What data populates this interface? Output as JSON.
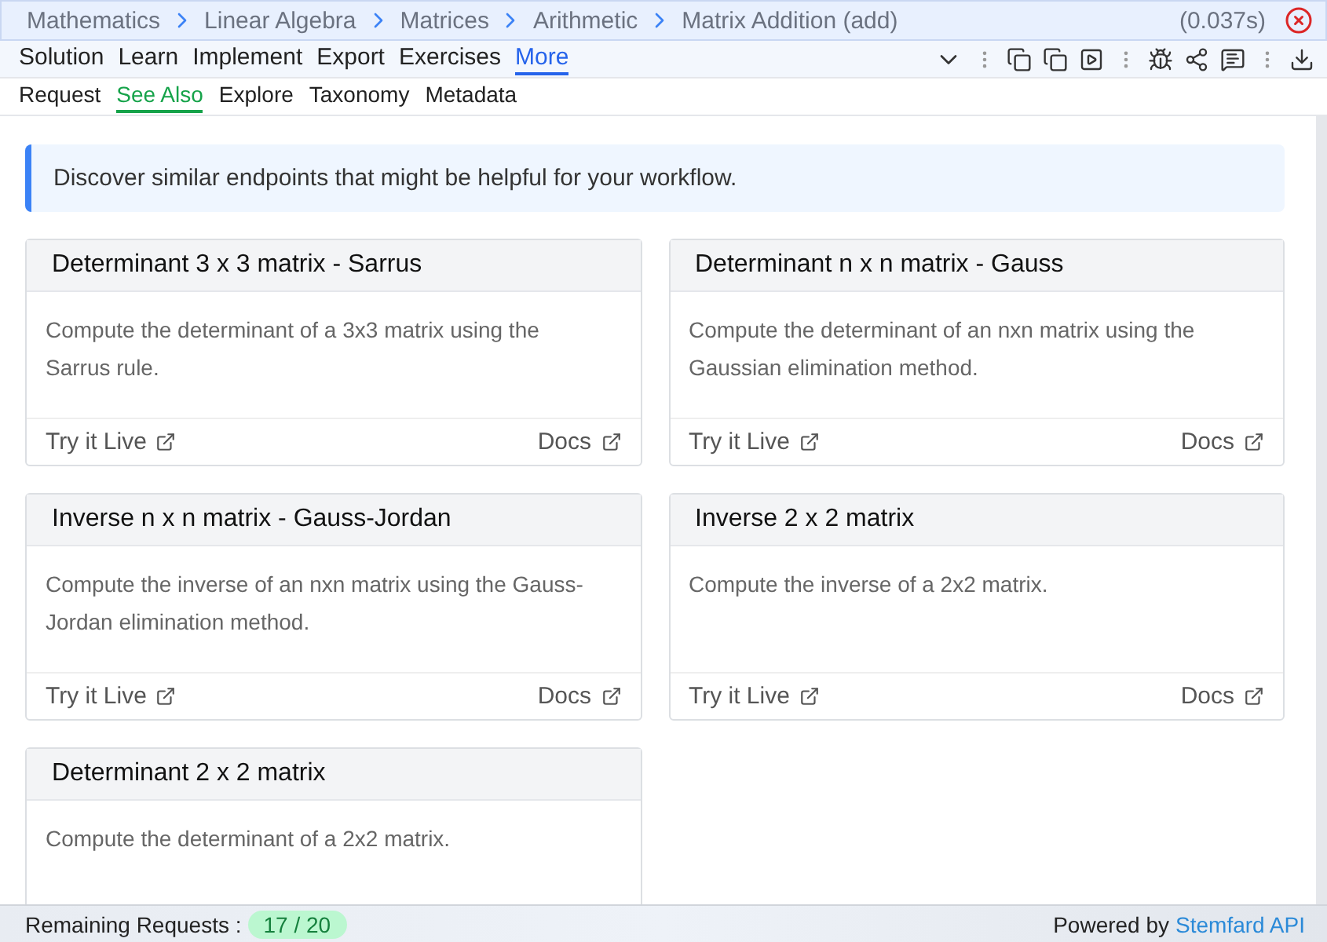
{
  "breadcrumb": [
    {
      "label": "Mathematics"
    },
    {
      "label": "Linear Algebra"
    },
    {
      "label": "Matrices"
    },
    {
      "label": "Arithmetic"
    },
    {
      "label": "Matrix Addition (add)"
    }
  ],
  "timing": "(0.037s)",
  "menu": [
    {
      "label": "Solution",
      "selected": false
    },
    {
      "label": "Learn",
      "selected": false
    },
    {
      "label": "Implement",
      "selected": false
    },
    {
      "label": "Export",
      "selected": false
    },
    {
      "label": "Exercises",
      "selected": false
    },
    {
      "label": "More",
      "selected": true
    }
  ],
  "subtabs": [
    {
      "label": "Request",
      "selected": false
    },
    {
      "label": "See Also",
      "selected": true
    },
    {
      "label": "Explore",
      "selected": false
    },
    {
      "label": "Taxonomy",
      "selected": false
    },
    {
      "label": "Metadata",
      "selected": false
    }
  ],
  "notice": "Discover similar endpoints that might be helpful for your workflow.",
  "cards": [
    {
      "title": "Determinant 3 x 3 matrix - Sarrus",
      "description": "Compute the determinant of a 3x3 matrix using the Sarrus rule.",
      "try_label": "Try it Live",
      "docs_label": "Docs"
    },
    {
      "title": "Determinant n x n matrix - Gauss",
      "description": "Compute the determinant of an nxn matrix using the Gaussian elimination method.",
      "try_label": "Try it Live",
      "docs_label": "Docs"
    },
    {
      "title": "Inverse n x n matrix - Gauss-Jordan",
      "description": "Compute the inverse of an nxn matrix using the Gauss-Jordan elimination method.",
      "try_label": "Try it Live",
      "docs_label": "Docs"
    },
    {
      "title": "Inverse 2 x 2 matrix",
      "description": "Compute the inverse of a 2x2 matrix.",
      "try_label": "Try it Live",
      "docs_label": "Docs"
    },
    {
      "title": "Determinant 2 x 2 matrix",
      "description": "Compute the determinant of a 2x2 matrix."
    }
  ],
  "status_bar": {
    "remaining_label": "Remaining Requests :",
    "remaining_count": "17 / 20",
    "powered_by": "Powered by",
    "brand": "Stemfard API"
  }
}
